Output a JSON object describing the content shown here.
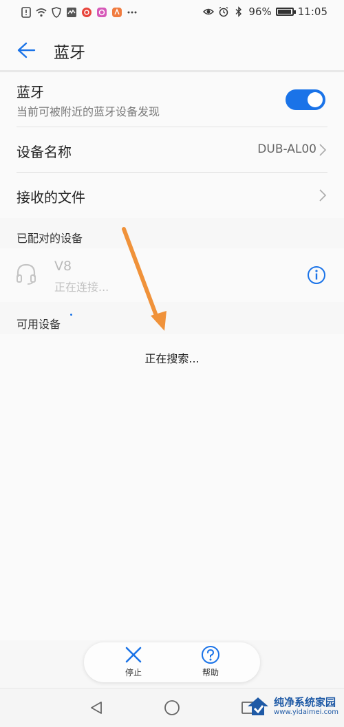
{
  "status_bar": {
    "battery": "96%",
    "battery_level": 0.96,
    "time": "11:05"
  },
  "app_bar": {
    "title": "蓝牙"
  },
  "bluetooth": {
    "title": "蓝牙",
    "subtitle": "当前可被附近的蓝牙设备发现",
    "enabled": true
  },
  "device_name": {
    "label": "设备名称",
    "value": "DUB-AL00"
  },
  "received_files": {
    "label": "接收的文件"
  },
  "paired": {
    "header": "已配对的设备",
    "devices": [
      {
        "name": "V8",
        "status": "正在连接..."
      }
    ]
  },
  "available": {
    "header": "可用设备",
    "searching": "正在搜索..."
  },
  "bottom_actions": {
    "stop_label": "停止",
    "help_label": "帮助"
  },
  "colors": {
    "accent": "#1a73e8",
    "arrow": "#f0923a"
  },
  "watermark": {
    "text": "纯净系统家园",
    "url": "www.yidaimei.com"
  }
}
